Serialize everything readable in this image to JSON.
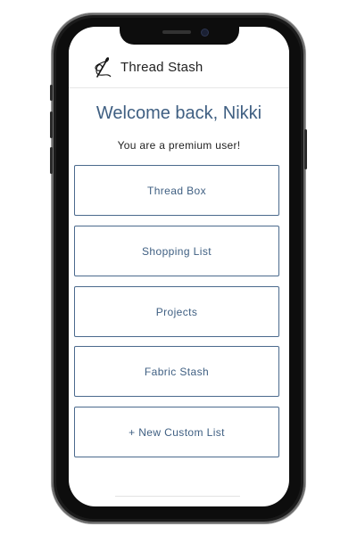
{
  "app": {
    "title": "Thread Stash",
    "logo_icon": "needle-thread-icon"
  },
  "welcome": {
    "text": "Welcome back, Nikki"
  },
  "status": {
    "text": "You are a premium user!"
  },
  "menu": {
    "items": [
      {
        "label": "Thread Box"
      },
      {
        "label": "Shopping List"
      },
      {
        "label": "Projects"
      },
      {
        "label": "Fabric Stash"
      },
      {
        "label": "+ New Custom List"
      }
    ]
  },
  "colors": {
    "accent": "#3f5f82",
    "border": "#4b6a8d",
    "frame": "#1b1b1b"
  }
}
